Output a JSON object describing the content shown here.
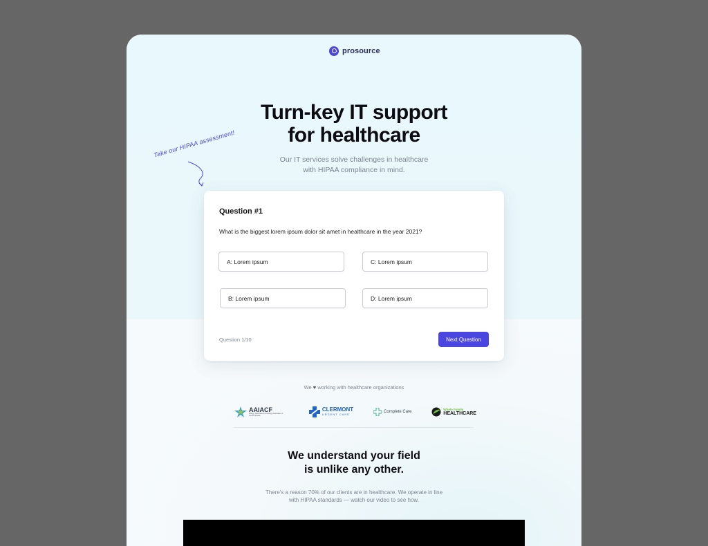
{
  "brand": {
    "name": "prosource",
    "accent": "#4b46e0"
  },
  "hero": {
    "title_line1": "Turn-key IT support",
    "title_line2": "for healthcare",
    "subtitle_line1": "Our IT services solve challenges in healthcare",
    "subtitle_line2": "with HIPAA compliance in mind.",
    "annotation": "Take our HIPAA assessment!"
  },
  "quiz": {
    "title": "Question #1",
    "question": "What is the biggest lorem ipsum dolor sit amet in healthcare in the year 2021?",
    "options": [
      {
        "label": "A: Lorem ipsum"
      },
      {
        "label": "B: Lorem ipsum"
      },
      {
        "label": "C: Lorem ipsum"
      },
      {
        "label": "D: Lorem ipsum"
      }
    ],
    "progress": "Question 1/10",
    "next_label": "Next Question"
  },
  "partners": {
    "intro_before": "We",
    "intro_heart": "♥",
    "intro_after": "working with healthcare organizations",
    "logos": [
      {
        "name": "AAIACF",
        "sub": "Allergy, Asthma & Immunology Associates of Central Florida"
      },
      {
        "name": "CLERMONT",
        "sub": "URGENT CARE"
      },
      {
        "name": "Complete Care",
        "sub": ""
      },
      {
        "name": "Whole Family",
        "sub": "HEALTHCARE"
      }
    ]
  },
  "section": {
    "title_line1": "We understand your field",
    "title_line2": "is unlike any other.",
    "body_line1": "There's a reason 70% of our clients are in healthcare. We operate in line",
    "body_line2": "with HIPAA standards — watch our video to see how."
  }
}
